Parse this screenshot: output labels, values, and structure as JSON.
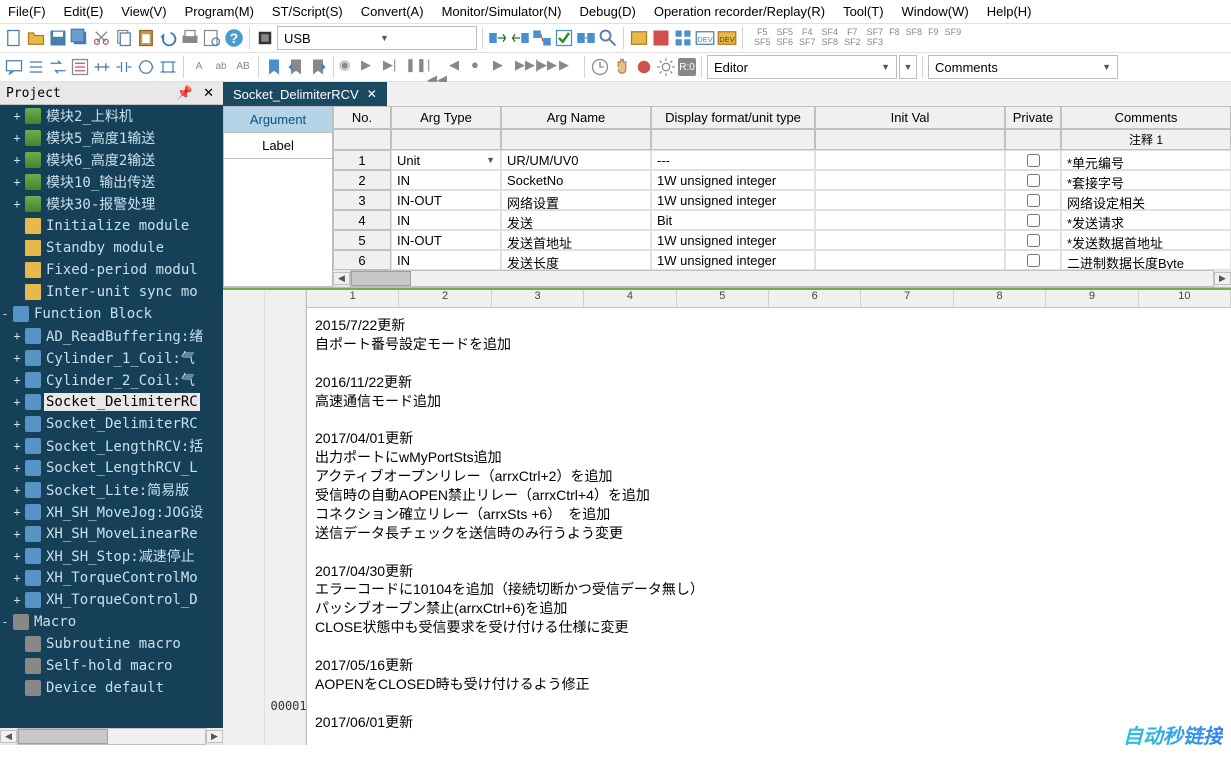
{
  "menu": [
    "File(F)",
    "Edit(E)",
    "View(V)",
    "Program(M)",
    "ST/Script(S)",
    "Convert(A)",
    "Monitor/Simulator(N)",
    "Debug(D)",
    "Operation recorder/Replay(R)",
    "Tool(T)",
    "Window(W)",
    "Help(H)"
  ],
  "connection": {
    "label": "USB"
  },
  "sf_keys": [
    {
      "top": "F5",
      "bot": "SF5"
    },
    {
      "top": "SF5",
      "bot": "SF6"
    },
    {
      "top": "F4",
      "bot": "SF7"
    },
    {
      "top": "SF4",
      "bot": "SF8"
    },
    {
      "top": "F7",
      "bot": "SF2"
    },
    {
      "top": "SF7",
      "bot": "SF3"
    },
    {
      "top": "F8",
      "bot": ""
    },
    {
      "top": "SF8",
      "bot": ""
    },
    {
      "top": "F9",
      "bot": ""
    },
    {
      "top": "SF9",
      "bot": ""
    }
  ],
  "dropdowns": {
    "editor": "Editor",
    "comments": "Comments"
  },
  "panel": {
    "title": "Project"
  },
  "tree": [
    {
      "lvl": 1,
      "icon": "ladder",
      "exp": "+",
      "label": "模块2_上料机"
    },
    {
      "lvl": 1,
      "icon": "ladder",
      "exp": "+",
      "label": "模块5_高度1输送"
    },
    {
      "lvl": 1,
      "icon": "ladder",
      "exp": "+",
      "label": "模块6_高度2输送"
    },
    {
      "lvl": 1,
      "icon": "ladder",
      "exp": "+",
      "label": "模块10_输出传送"
    },
    {
      "lvl": 1,
      "icon": "ladder",
      "exp": "+",
      "label": "模块30-报警处理"
    },
    {
      "lvl": 1,
      "icon": "folder",
      "exp": "",
      "label": "Initialize module"
    },
    {
      "lvl": 1,
      "icon": "folder",
      "exp": "",
      "label": "Standby module"
    },
    {
      "lvl": 1,
      "icon": "folder",
      "exp": "",
      "label": "Fixed-period modul"
    },
    {
      "lvl": 1,
      "icon": "folder",
      "exp": "",
      "label": "Inter-unit sync mo"
    },
    {
      "lvl": 0,
      "icon": "fb",
      "exp": "-",
      "label": "Function Block"
    },
    {
      "lvl": 1,
      "icon": "fb",
      "exp": "+",
      "label": "AD_ReadBuffering:绪"
    },
    {
      "lvl": 1,
      "icon": "fb",
      "exp": "+",
      "label": "Cylinder_1_Coil:气"
    },
    {
      "lvl": 1,
      "icon": "fb",
      "exp": "+",
      "label": "Cylinder_2_Coil:气"
    },
    {
      "lvl": 1,
      "icon": "fb",
      "exp": "+",
      "label": "Socket_DelimiterRC",
      "selected": true
    },
    {
      "lvl": 1,
      "icon": "fb",
      "exp": "+",
      "label": "Socket_DelimiterRC"
    },
    {
      "lvl": 1,
      "icon": "fb",
      "exp": "+",
      "label": "Socket_LengthRCV:括"
    },
    {
      "lvl": 1,
      "icon": "fb",
      "exp": "+",
      "label": "Socket_LengthRCV_L"
    },
    {
      "lvl": 1,
      "icon": "fb",
      "exp": "+",
      "label": "Socket_Lite:简易版"
    },
    {
      "lvl": 1,
      "icon": "fb",
      "exp": "+",
      "label": "XH_SH_MoveJog:JOG设"
    },
    {
      "lvl": 1,
      "icon": "fb",
      "exp": "+",
      "label": "XH_SH_MoveLinearRe"
    },
    {
      "lvl": 1,
      "icon": "fb",
      "exp": "+",
      "label": "XH_SH_Stop:减速停止"
    },
    {
      "lvl": 1,
      "icon": "fb",
      "exp": "+",
      "label": "XH_TorqueControlMo"
    },
    {
      "lvl": 1,
      "icon": "fb",
      "exp": "+",
      "label": "XH_TorqueControl_D"
    },
    {
      "lvl": 0,
      "icon": "macro",
      "exp": "-",
      "label": "Macro"
    },
    {
      "lvl": 1,
      "icon": "macro",
      "exp": "",
      "label": "Subroutine macro"
    },
    {
      "lvl": 1,
      "icon": "macro",
      "exp": "",
      "label": "Self-hold macro"
    },
    {
      "lvl": 1,
      "icon": "macro",
      "exp": "",
      "label": "Device default"
    }
  ],
  "editor_tab": {
    "name": "Socket_DelimiterRCV"
  },
  "arg_tabs": {
    "argument": "Argument",
    "label": "Label"
  },
  "arg_headers": {
    "no": "No.",
    "type": "Arg Type",
    "name": "Arg Name",
    "disp": "Display format/unit type",
    "init": "Init Val",
    "priv": "Private",
    "comments": "Comments",
    "comment1": "注释 1"
  },
  "arg_rows": [
    {
      "no": "1",
      "type": "Unit",
      "name": "UR/UM/UV0",
      "disp": "---",
      "init": "",
      "comment": "*单元编号",
      "unit": true
    },
    {
      "no": "2",
      "type": "IN",
      "name": "SocketNo",
      "disp": "1W unsigned integer",
      "init": "",
      "comment": "*套接字号"
    },
    {
      "no": "3",
      "type": "IN-OUT",
      "name": "网络设置",
      "disp": "1W unsigned integer",
      "init": "",
      "comment": "网络设定相关"
    },
    {
      "no": "4",
      "type": "IN",
      "name": "发送",
      "disp": "Bit",
      "init": "",
      "comment": "*发送请求"
    },
    {
      "no": "5",
      "type": "IN-OUT",
      "name": "发送首地址",
      "disp": "1W unsigned integer",
      "init": "",
      "comment": "*发送数据首地址"
    },
    {
      "no": "6",
      "type": "IN",
      "name": "发送长度",
      "disp": "1W unsigned integer",
      "init": "",
      "comment": "二进制数据长度Byte"
    }
  ],
  "ruler": [
    "1",
    "2",
    "3",
    "4",
    "5",
    "6",
    "7",
    "8",
    "9",
    "10"
  ],
  "line_num": "00001",
  "code": "2015/7/22更新\n自ポート番号設定モードを追加\n\n2016/11/22更新\n高速通信モード追加\n\n2017/04/01更新\n出力ポートにwMyPortSts追加\nアクティブオープンリレー（arrxCtrl+2）を追加\n受信時の自動AOPEN禁止リレー（arrxCtrl+4）を追加\nコネクション確立リレー（arrxSts +6）　を追加\n送信データ長チェックを送信時のみ行うよう変更\n\n2017/04/30更新\nエラーコードに10104を追加（接続切断かつ受信データ無し）\nパッシブオープン禁止(arrxCtrl+6)を追加\nCLOSE状態中も受信要求を受け付ける仕様に変更\n\n2017/05/16更新\nAOPENをCLOSED時も受け付けるよう修正\n\n2017/06/01更新",
  "watermark": "自动秒链接"
}
